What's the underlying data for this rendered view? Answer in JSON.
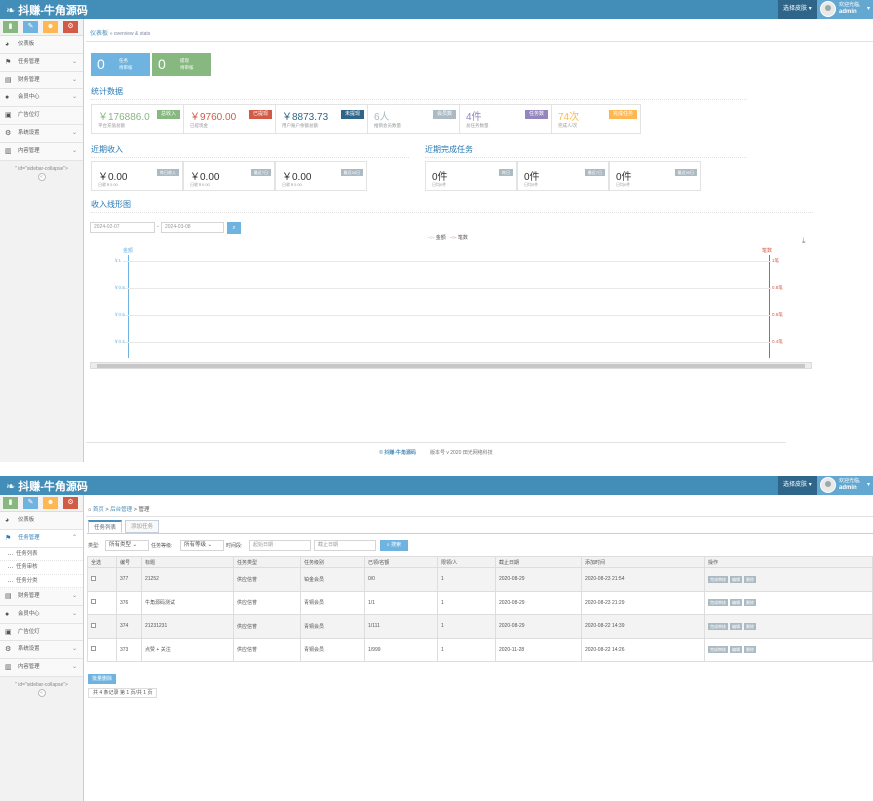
{
  "topbar": {
    "brand": "抖赚-牛角源码",
    "switch_btn": "选择皮肤",
    "welcome": "欢迎光临,",
    "user": "admin"
  },
  "sidebar": {
    "items": [
      {
        "label": "仪表板",
        "icon": "dashboard-icon"
      },
      {
        "label": "任务管理",
        "icon": "flag-icon"
      },
      {
        "label": "财务管理",
        "icon": "wallet-icon"
      },
      {
        "label": "会员中心",
        "icon": "user-icon"
      },
      {
        "label": "广告位灯",
        "icon": "picture-icon"
      },
      {
        "label": "系统设置",
        "icon": "gear-icon"
      },
      {
        "label": "内容管理",
        "icon": "book-icon"
      }
    ],
    "sub_items": [
      "任务列表",
      "任务审核",
      "任务分类"
    ],
    "collapse_text": "\" id=\"sidebar-collapse\">"
  },
  "dashboard": {
    "breadcrumb": "仪表板",
    "breadcrumb_sub": "» overview & stats",
    "boxes": [
      {
        "num": "0",
        "label1": "任务",
        "label2": "待审核",
        "color": "#6fb3e0"
      },
      {
        "num": "0",
        "label1": "提现",
        "label2": "待审核",
        "color": "#87b87f"
      }
    ],
    "stats_title": "统计数据",
    "stats": [
      {
        "value": "￥176886.0",
        "desc": "平台充值总额",
        "badge": "总收入",
        "color": "#87b87f"
      },
      {
        "value": "￥9760.00",
        "desc": "已提现金",
        "badge": "已提现",
        "color": "#d15b47"
      },
      {
        "value": "￥8873.73",
        "desc": "用户账户余额总额",
        "badge": "未提现",
        "color": "#2e6589"
      },
      {
        "value": "6人",
        "desc": "推销会员数量",
        "badge": "会员数",
        "color": "#abbac3"
      },
      {
        "value": "4件",
        "desc": "总任务数量",
        "badge": "任务数",
        "color": "#9585bf"
      },
      {
        "value": "74次",
        "desc": "完成人/次",
        "badge": "完成任务",
        "color": "#ffb752"
      }
    ],
    "income_title": "近期收入",
    "income": [
      {
        "value": "￥0.00",
        "desc": "日收￥0.00",
        "badge": "昨日收入"
      },
      {
        "value": "￥0.00",
        "desc": "日收￥0.00",
        "badge": "最近7日"
      },
      {
        "value": "￥0.00",
        "desc": "日收￥0.00",
        "badge": "最近30日"
      }
    ],
    "tasks_title": "近期完成任务",
    "tasks": [
      {
        "value": "0件",
        "desc": "日均0件",
        "badge": "昨日"
      },
      {
        "value": "0件",
        "desc": "日均0件",
        "badge": "最近7日"
      },
      {
        "value": "0件",
        "desc": "日均0件",
        "badge": "最近30日"
      }
    ],
    "chart_title": "收入线形图",
    "date_from": "2024-02-07",
    "date_to": "2024-03-08",
    "date_sep": "-",
    "footer_brand": "© 抖赚-牛角源码",
    "footer_version": "版本号 v 2020 田光网络科技"
  },
  "chart_data": {
    "type": "line",
    "title": "",
    "series": [
      {
        "name": "金额",
        "axis": "left",
        "values": [],
        "color": "#6fb3e0"
      },
      {
        "name": "笔数",
        "axis": "right",
        "values": [],
        "color": "#d15b47"
      }
    ],
    "left_axis_label": "金额",
    "right_axis_label": "笔数",
    "left_ticks": [
      "￥1",
      "￥0.8",
      "￥0.6",
      "￥0.4"
    ],
    "right_ticks": [
      "1笔",
      "0.8笔",
      "0.6笔",
      "0.4笔"
    ],
    "ylim": [
      0,
      1
    ],
    "grid": true,
    "legend": "top-center"
  },
  "tasks_page": {
    "breadcrumb_home": "首页",
    "breadcrumb_mid": "后台管理",
    "breadcrumb_cur": "管理",
    "tabs": [
      "任务列表",
      "添加任务"
    ],
    "filter": {
      "type_label": "类型:",
      "type_value": "所有类型",
      "level_label": "任务等级:",
      "level_value": "所有等级",
      "time_label": "时间段:",
      "start_ph": "起始日期",
      "end_ph": "截止日期",
      "search_btn": "搜索"
    },
    "columns": [
      "全选",
      "编号",
      "标题",
      "任务类型",
      "任务级别",
      "已领/名额",
      "限领/人",
      "截止日期",
      "添加时间",
      "操作"
    ],
    "rows": [
      [
        "377",
        "21252",
        "供应信誉",
        "铂金会员",
        "0/0",
        "1",
        "2020-08-29",
        "2020-08-23 21:54"
      ],
      [
        "376",
        "牛角源码测试",
        "供应信誉",
        "青铜会员",
        "1/1",
        "1",
        "2020-08-29",
        "2020-08-23 21:29"
      ],
      [
        "374",
        "21231231",
        "供应信誉",
        "青铜会员",
        "1/111",
        "1",
        "2020-08-29",
        "2020-08-22 14:39"
      ],
      [
        "373",
        "点赞 + 关注",
        "供应信誉",
        "青铜会员",
        "1/999",
        "1",
        "2020-11-28",
        "2020-08-22 14:26"
      ]
    ],
    "ops": [
      "完成审核",
      "编辑",
      "删除"
    ],
    "bulk_delete": "批量删除",
    "pager": "共 4 条记录 第 1 页/共 1 页"
  }
}
